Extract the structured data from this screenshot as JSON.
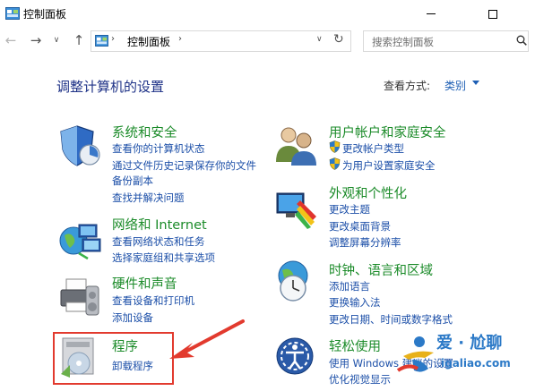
{
  "window": {
    "title": "控制面板"
  },
  "nav": {
    "address_text": "控制面板",
    "search_placeholder": "搜索控制面板"
  },
  "header": {
    "page_title": "调整计算机的设置",
    "view_by_label": "查看方式:",
    "view_by_value": "类别"
  },
  "categories": [
    {
      "title": "系统和安全",
      "links": [
        "查看你的计算机状态",
        "通过文件历史记录保存你的文件",
        "备份副本",
        "查找并解决问题"
      ]
    },
    {
      "title": "网络和 Internet",
      "links": [
        "查看网络状态和任务",
        "选择家庭组和共享选项"
      ]
    },
    {
      "title": "硬件和声音",
      "links": [
        "查看设备和打印机",
        "添加设备"
      ]
    },
    {
      "title": "程序",
      "links": [
        "卸载程序"
      ]
    },
    {
      "title": "用户帐户和家庭安全",
      "links": [
        "更改帐户类型",
        "为用户设置家庭安全"
      ]
    },
    {
      "title": "外观和个性化",
      "links": [
        "更改主题",
        "更改桌面背景",
        "调整屏幕分辨率"
      ]
    },
    {
      "title": "时钟、语言和区域",
      "links": [
        "添加语言",
        "更换输入法",
        "更改日期、时间或数字格式"
      ]
    },
    {
      "title": "轻松使用",
      "links": [
        "使用 Windows 建议的设置",
        "优化视觉显示"
      ]
    }
  ],
  "watermark": {
    "text": "爱 · 尬聊",
    "url": "igaliao.com"
  },
  "colors": {
    "category_title": "#1b8b29",
    "link": "#1c4fa8",
    "page_title": "#1e3287",
    "highlight": "#e23a2e"
  }
}
